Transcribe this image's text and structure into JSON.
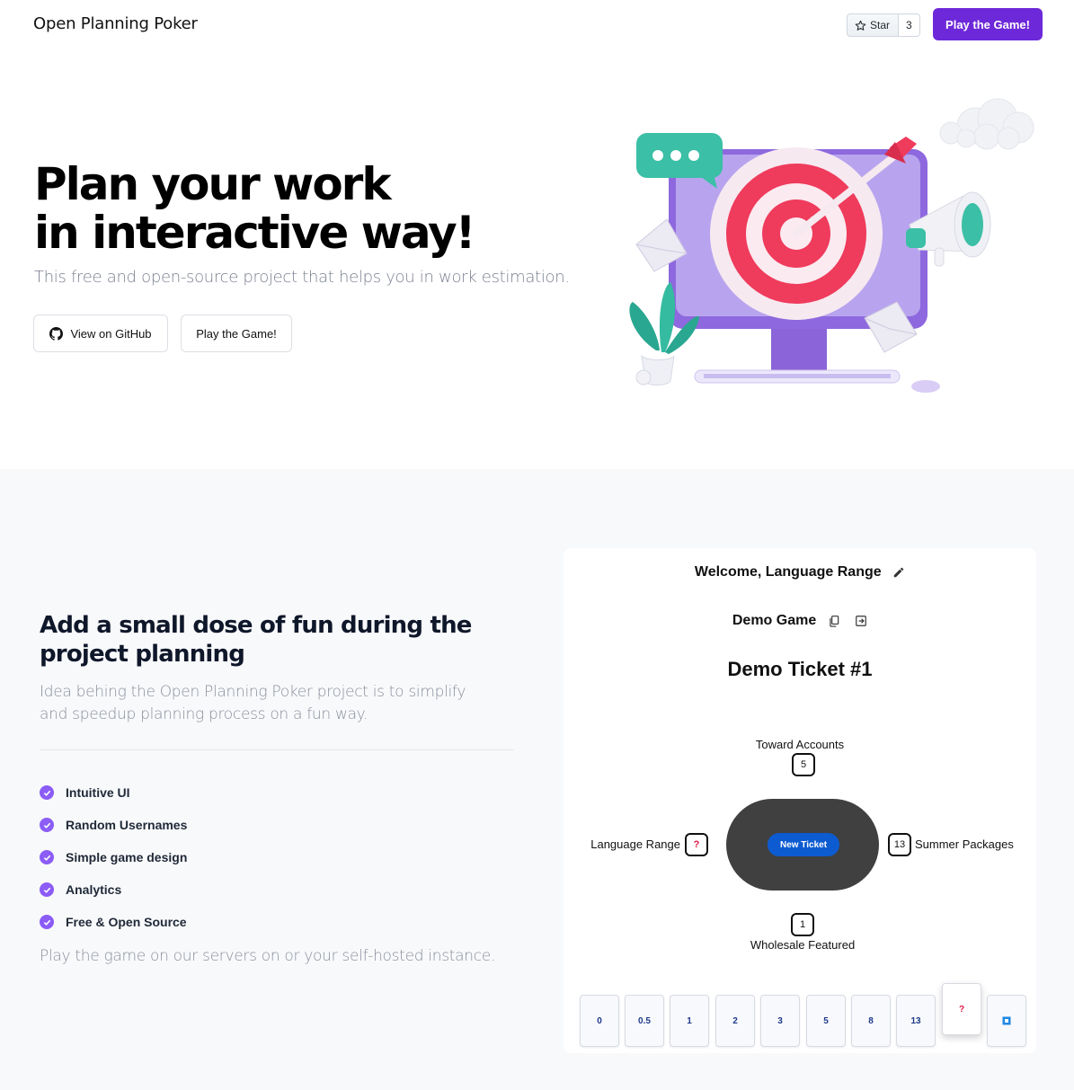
{
  "header": {
    "brand": "Open Planning Poker",
    "star_label": "Star",
    "star_count": "3",
    "play_button": "Play the Game!"
  },
  "hero": {
    "title_line1": "Plan your work",
    "title_line2": "in interactive way!",
    "subtitle": "This free and open-source project that helps you in work estimation.",
    "github_button": "View on GitHub",
    "play_button": "Play the Game!"
  },
  "section2": {
    "title": "Add a small dose of fun during the project planning",
    "description": "Idea behing the Open Planning Poker project is to simplify and speedup planning process on a fun way.",
    "features": [
      "Intuitive UI",
      "Random Usernames",
      "Simple game design",
      "Analytics",
      "Free & Open Source"
    ],
    "footer": "Play the game on our servers on or your self-hosted instance."
  },
  "demo": {
    "welcome": "Welcome, Language Range",
    "game_name": "Demo Game",
    "ticket": "Demo Ticket #1",
    "new_ticket_button": "New Ticket",
    "players": {
      "top": {
        "name": "Toward Accounts",
        "vote": "5"
      },
      "left": {
        "name": "Language Range",
        "vote": "?"
      },
      "right": {
        "name": "Summer Packages",
        "vote": "13"
      },
      "bottom": {
        "name": "Wholesale Featured",
        "vote": "1"
      }
    },
    "deck": [
      "0",
      "0.5",
      "1",
      "2",
      "3",
      "5",
      "8",
      "13",
      "?"
    ],
    "coffee_icon": "coffee-icon"
  },
  "colors": {
    "accent": "#6d28d9",
    "check": "#8b5cf6",
    "table": "#404040",
    "new_ticket": "#0d5bd1"
  }
}
